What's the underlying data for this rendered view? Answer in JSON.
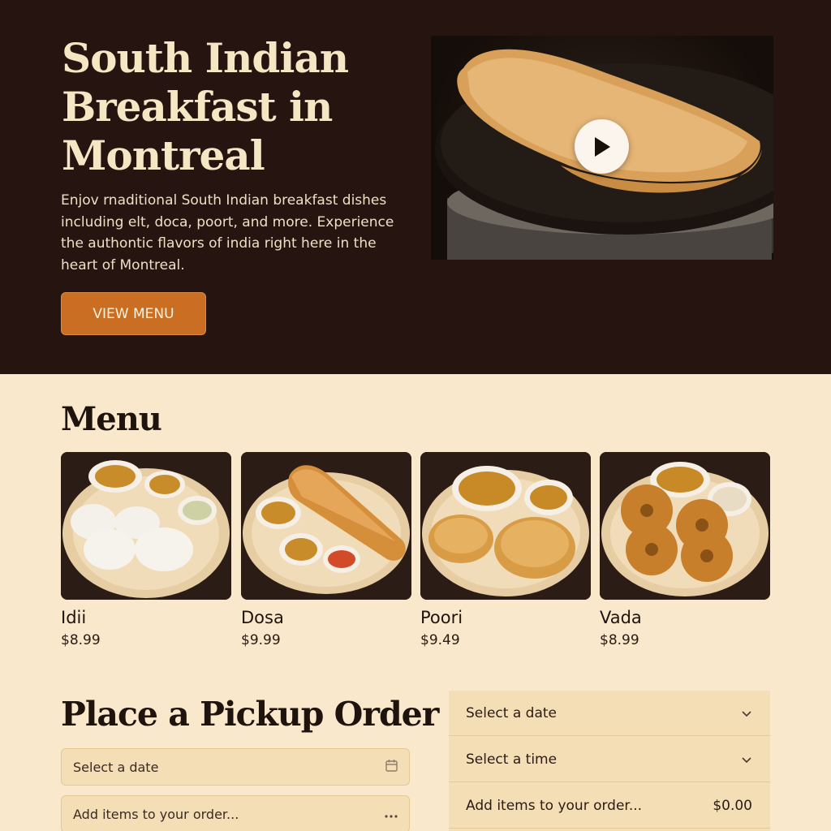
{
  "hero": {
    "title": "South Indian Breakfast in Montreal",
    "description": "Enjov rnaditional South Indian breakfast dishes including elt, doca, poort, and more. Experience the authontic flavors of india right here in the heart of Montreal.",
    "cta_label": "VIEW MENU",
    "video_icon": "play-icon"
  },
  "menu": {
    "heading": "Menu",
    "items": [
      {
        "name": "Idii",
        "price": "$8.99"
      },
      {
        "name": "Dosa",
        "price": "$9.99"
      },
      {
        "name": "Poori",
        "price": "$9.49"
      },
      {
        "name": "Vada",
        "price": "$8.99"
      }
    ]
  },
  "order": {
    "heading": "Place a Pickup Order",
    "date_field": {
      "placeholder": "Select a date",
      "icon": "calendar-icon"
    },
    "items_field": {
      "placeholder": "Add items to your order...",
      "icon": "more-icon"
    }
  },
  "summary": {
    "date_label": "Select a date",
    "time_label": "Select a time",
    "items_label": "Add items to your order...",
    "total": "$0.00"
  },
  "colors": {
    "hero_bg": "#261410",
    "page_bg": "#f9e8cb",
    "accent": "#c96e22",
    "heading_text": "#1f130e",
    "hero_text": "#f5e6c4"
  }
}
